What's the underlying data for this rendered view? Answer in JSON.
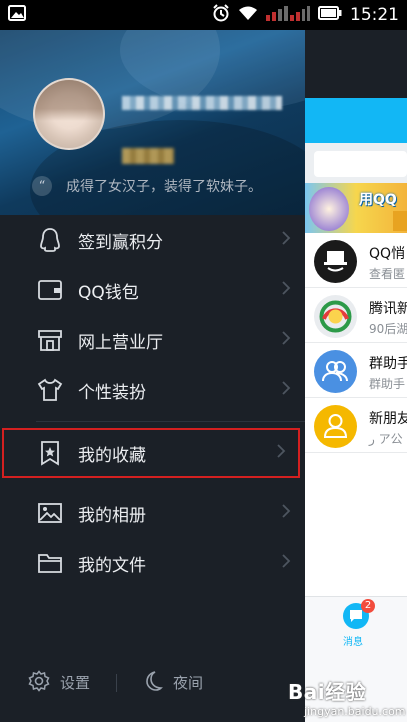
{
  "status_bar": {
    "time": "15:21",
    "icons": [
      "image-icon",
      "alarm-icon",
      "wifi-icon",
      "signal-icon",
      "battery-icon"
    ]
  },
  "drawer": {
    "signature": "成得了女汉子，装得了软妹子。",
    "menu": [
      {
        "id": "checkin",
        "icon": "penguin-icon",
        "label": "签到赢积分"
      },
      {
        "id": "wallet",
        "icon": "wallet-icon",
        "label": "QQ钱包"
      },
      {
        "id": "hall",
        "icon": "store-icon",
        "label": "网上营业厅"
      },
      {
        "id": "dress",
        "icon": "shirt-icon",
        "label": "个性装扮"
      },
      {
        "id": "favorites",
        "icon": "bookmark-star-icon",
        "label": "我的收藏",
        "highlighted": true
      },
      {
        "id": "album",
        "icon": "photo-icon",
        "label": "我的相册"
      },
      {
        "id": "files",
        "icon": "folder-icon",
        "label": "我的文件"
      }
    ],
    "footer": {
      "settings_label": "设置",
      "night_label": "夜间"
    },
    "colors": {
      "highlight_border": "#d42020",
      "drawer_bg": "#1b2027"
    }
  },
  "peek": {
    "banner_title": "用QQ",
    "conversations": [
      {
        "name": "QQ悄",
        "msg": "查看匿",
        "avatar_color": "#1a1a1a"
      },
      {
        "name": "腾讯新",
        "msg": "90后湖",
        "avatar_color": "#e9ecef"
      },
      {
        "name": "群助手",
        "msg": "群助手",
        "avatar_color": "#4a90e2"
      },
      {
        "name": "新朋友",
        "msg": "ر ア公",
        "avatar_color": "#f5b800"
      }
    ],
    "tab_badge": "2",
    "tab_label": "消息",
    "accent": "#12b7f5"
  },
  "watermark": {
    "brand": "Bai经验",
    "sub": "jingyan.baidu.com"
  }
}
